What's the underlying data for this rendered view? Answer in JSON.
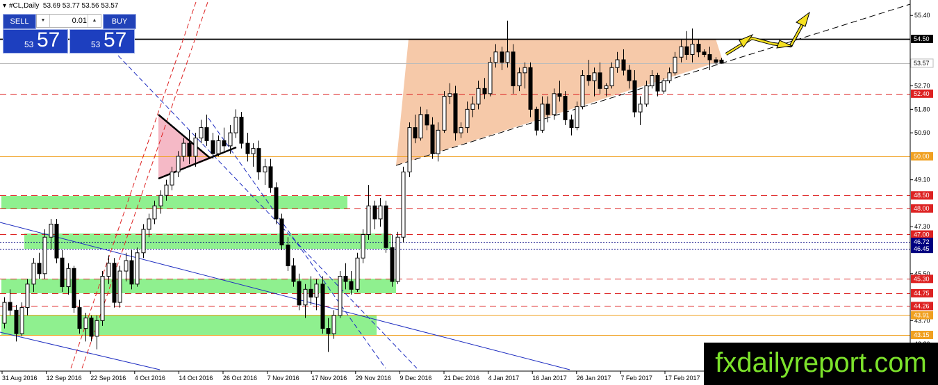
{
  "window": {
    "title": "#CL,Daily",
    "ohlc": "53.69 53.77 53.56 53.57"
  },
  "trade_panel": {
    "sell_label": "SELL",
    "buy_label": "BUY",
    "lot": "0.01",
    "sell_price_small": "53",
    "sell_price_big": "57",
    "buy_price_small": "53",
    "buy_price_big": "57"
  },
  "price_axis": {
    "ticks": [
      "55.40",
      "52.70",
      "51.80",
      "50.90",
      "49.10",
      "47.30",
      "45.50",
      "43.70",
      "42.80"
    ],
    "levels": [
      {
        "value": "54.50",
        "color": "#000000"
      },
      {
        "value": "53.57",
        "color": "#000000"
      },
      {
        "value": "52.40",
        "color": "#dd2222"
      },
      {
        "value": "50.00",
        "color": "#f0a020"
      },
      {
        "value": "48.50",
        "color": "#dd2222"
      },
      {
        "value": "48.00",
        "color": "#dd2222"
      },
      {
        "value": "47.00",
        "color": "#dd2222"
      },
      {
        "value": "46.72",
        "color": "#000080"
      },
      {
        "value": "46.45",
        "color": "#000080"
      },
      {
        "value": "45.30",
        "color": "#dd2222"
      },
      {
        "value": "44.75",
        "color": "#dd2222"
      },
      {
        "value": "44.26",
        "color": "#dd2222"
      },
      {
        "value": "43.91",
        "color": "#f0a020"
      },
      {
        "value": "43.15",
        "color": "#f0a020"
      }
    ]
  },
  "time_axis": [
    "31 Aug 2016",
    "12 Sep 2016",
    "22 Sep 2016",
    "4 Oct 2016",
    "14 Oct 2016",
    "26 Oct 2016",
    "7 Nov 2016",
    "17 Nov 2016",
    "29 Nov 2016",
    "9 Dec 2016",
    "21 Dec 2016",
    "4 Jan 2017",
    "16 Jan 2017",
    "26 Jan 2017",
    "7 Feb 2017",
    "17 Feb 2017"
  ],
  "watermark": "fxdailyreport.com",
  "colors": {
    "bull": "#ffffff",
    "bear": "#000000",
    "zone": "#8ff08f",
    "triangle": "#f5c09a",
    "pennant": "#f2a8b8"
  },
  "chart_data": {
    "type": "candlestick",
    "symbol": "#CL",
    "timeframe": "Daily",
    "last": {
      "open": 53.69,
      "high": 53.77,
      "low": 53.56,
      "close": 53.57
    },
    "price_range": [
      42.3,
      55.9
    ],
    "candles": [
      [
        43.6,
        44.6,
        43.4,
        44.4
      ],
      [
        44.4,
        44.9,
        43.9,
        44.1
      ],
      [
        44.1,
        44.3,
        42.9,
        43.2
      ],
      [
        43.2,
        44.4,
        43.1,
        44.2
      ],
      [
        44.2,
        45.3,
        43.9,
        45.1
      ],
      [
        45.1,
        46.1,
        44.8,
        45.9
      ],
      [
        45.9,
        46.3,
        45.3,
        45.5
      ],
      [
        45.5,
        47.2,
        45.3,
        46.9
      ],
      [
        46.9,
        47.6,
        46.4,
        47.4
      ],
      [
        47.4,
        47.6,
        45.9,
        46.1
      ],
      [
        46.1,
        46.4,
        44.8,
        45.0
      ],
      [
        45.0,
        45.9,
        44.7,
        45.7
      ],
      [
        45.7,
        45.8,
        44.0,
        44.2
      ],
      [
        44.2,
        44.5,
        43.2,
        43.4
      ],
      [
        43.4,
        44.0,
        42.9,
        43.8
      ],
      [
        43.8,
        43.9,
        42.9,
        43.1
      ],
      [
        43.1,
        43.9,
        42.6,
        43.7
      ],
      [
        43.7,
        45.6,
        43.5,
        45.4
      ],
      [
        45.4,
        46.2,
        45.1,
        45.9
      ],
      [
        45.9,
        46.1,
        44.2,
        44.4
      ],
      [
        44.4,
        45.8,
        44.2,
        45.6
      ],
      [
        45.6,
        46.3,
        45.2,
        46.0
      ],
      [
        46.0,
        46.4,
        44.9,
        45.1
      ],
      [
        45.1,
        46.5,
        45.0,
        46.3
      ],
      [
        46.3,
        47.4,
        46.1,
        47.2
      ],
      [
        47.2,
        47.8,
        46.9,
        47.6
      ],
      [
        47.6,
        48.3,
        47.4,
        48.1
      ],
      [
        48.1,
        48.7,
        47.8,
        48.5
      ],
      [
        48.5,
        49.1,
        48.3,
        48.9
      ],
      [
        48.9,
        49.6,
        48.7,
        49.4
      ],
      [
        49.4,
        50.2,
        49.2,
        50.0
      ],
      [
        50.0,
        50.7,
        49.8,
        50.5
      ],
      [
        50.5,
        51.0,
        49.7,
        50.0
      ],
      [
        50.0,
        50.9,
        49.6,
        50.7
      ],
      [
        50.7,
        51.4,
        50.5,
        51.1
      ],
      [
        51.1,
        51.6,
        50.4,
        50.6
      ],
      [
        50.6,
        50.9,
        49.9,
        50.1
      ],
      [
        50.1,
        50.8,
        50.0,
        50.6
      ],
      [
        50.6,
        51.1,
        50.2,
        50.4
      ],
      [
        50.4,
        51.2,
        50.1,
        50.9
      ],
      [
        50.9,
        51.8,
        50.7,
        51.5
      ],
      [
        51.5,
        51.7,
        50.3,
        50.5
      ],
      [
        50.5,
        50.9,
        49.8,
        50.1
      ],
      [
        50.1,
        50.5,
        49.6,
        50.3
      ],
      [
        50.3,
        50.6,
        49.1,
        49.4
      ],
      [
        49.4,
        49.9,
        48.9,
        49.6
      ],
      [
        49.6,
        49.9,
        48.6,
        48.8
      ],
      [
        48.8,
        49.0,
        47.4,
        47.6
      ],
      [
        47.6,
        47.8,
        46.4,
        46.6
      ],
      [
        46.6,
        46.9,
        45.6,
        45.8
      ],
      [
        45.8,
        46.1,
        45.0,
        45.2
      ],
      [
        45.2,
        45.5,
        44.1,
        44.3
      ],
      [
        44.3,
        45.1,
        43.8,
        44.9
      ],
      [
        44.9,
        45.4,
        44.3,
        44.6
      ],
      [
        44.6,
        45.3,
        44.1,
        45.1
      ],
      [
        45.1,
        45.4,
        43.2,
        43.4
      ],
      [
        43.4,
        43.8,
        42.5,
        43.2
      ],
      [
        43.2,
        44.1,
        43.0,
        43.9
      ],
      [
        43.9,
        45.6,
        43.8,
        45.4
      ],
      [
        45.4,
        45.9,
        44.9,
        45.2
      ],
      [
        45.2,
        45.6,
        44.7,
        44.9
      ],
      [
        44.9,
        46.3,
        44.8,
        46.1
      ],
      [
        46.1,
        47.2,
        45.9,
        47.0
      ],
      [
        47.0,
        48.9,
        46.8,
        48.1
      ],
      [
        48.1,
        48.3,
        47.2,
        47.6
      ],
      [
        47.6,
        48.4,
        47.3,
        48.1
      ],
      [
        48.1,
        48.3,
        46.3,
        46.5
      ],
      [
        46.5,
        47.0,
        45.0,
        45.2
      ],
      [
        45.2,
        47.1,
        45.1,
        46.9
      ],
      [
        46.9,
        49.6,
        46.7,
        49.4
      ],
      [
        49.4,
        51.3,
        49.2,
        51.1
      ],
      [
        51.1,
        51.6,
        50.5,
        50.7
      ],
      [
        50.7,
        51.9,
        50.6,
        51.6
      ],
      [
        51.6,
        51.8,
        51.0,
        51.2
      ],
      [
        51.2,
        51.5,
        49.9,
        50.1
      ],
      [
        50.1,
        51.3,
        49.8,
        51.0
      ],
      [
        51.0,
        52.5,
        50.9,
        52.3
      ],
      [
        52.3,
        52.8,
        52.0,
        52.4
      ],
      [
        52.4,
        52.7,
        50.6,
        50.9
      ],
      [
        50.9,
        51.3,
        50.7,
        51.1
      ],
      [
        51.1,
        52.1,
        50.9,
        51.8
      ],
      [
        51.8,
        52.3,
        51.5,
        52.0
      ],
      [
        52.0,
        52.9,
        51.8,
        52.6
      ],
      [
        52.6,
        53.0,
        52.2,
        52.4
      ],
      [
        52.4,
        53.8,
        52.3,
        53.6
      ],
      [
        53.6,
        54.3,
        53.4,
        54.0
      ],
      [
        54.0,
        54.2,
        53.3,
        53.6
      ],
      [
        53.6,
        55.2,
        53.4,
        54.0
      ],
      [
        54.0,
        54.3,
        52.4,
        52.7
      ],
      [
        52.7,
        53.4,
        52.5,
        53.2
      ],
      [
        53.2,
        53.6,
        52.6,
        53.4
      ],
      [
        53.4,
        53.6,
        51.5,
        51.8
      ],
      [
        51.8,
        51.9,
        50.8,
        51.0
      ],
      [
        51.0,
        52.3,
        50.9,
        52.0
      ],
      [
        52.0,
        52.3,
        51.3,
        51.6
      ],
      [
        51.6,
        52.6,
        51.4,
        52.4
      ],
      [
        52.4,
        52.9,
        52.1,
        52.3
      ],
      [
        52.3,
        52.5,
        51.2,
        51.4
      ],
      [
        51.4,
        51.6,
        50.8,
        51.1
      ],
      [
        51.1,
        52.1,
        51.0,
        51.9
      ],
      [
        51.9,
        53.3,
        51.8,
        53.1
      ],
      [
        53.1,
        53.7,
        52.7,
        52.9
      ],
      [
        52.9,
        53.4,
        52.3,
        53.2
      ],
      [
        53.2,
        53.6,
        52.4,
        52.6
      ],
      [
        52.6,
        52.8,
        52.3,
        52.7
      ],
      [
        52.7,
        53.6,
        52.6,
        53.4
      ],
      [
        53.4,
        54.0,
        53.2,
        53.7
      ],
      [
        53.7,
        54.1,
        53.1,
        53.3
      ],
      [
        53.3,
        53.5,
        52.6,
        52.9
      ],
      [
        52.9,
        53.3,
        51.5,
        51.7
      ],
      [
        51.7,
        52.3,
        51.2,
        52.0
      ],
      [
        52.0,
        52.9,
        51.9,
        52.7
      ],
      [
        52.7,
        53.3,
        52.6,
        53.1
      ],
      [
        53.1,
        53.2,
        52.3,
        52.5
      ],
      [
        52.5,
        53.0,
        52.4,
        52.9
      ],
      [
        52.9,
        53.4,
        52.8,
        53.2
      ],
      [
        53.2,
        54.0,
        53.1,
        53.8
      ],
      [
        53.8,
        54.5,
        53.6,
        54.2
      ],
      [
        54.2,
        54.8,
        53.7,
        53.9
      ],
      [
        53.9,
        54.9,
        53.6,
        54.3
      ],
      [
        54.3,
        54.5,
        53.8,
        54.0
      ],
      [
        54.0,
        54.1,
        53.8,
        53.9
      ],
      [
        53.9,
        54.2,
        53.3,
        53.7
      ],
      [
        53.7,
        53.8,
        53.5,
        53.6
      ],
      [
        53.69,
        53.77,
        53.56,
        53.57
      ]
    ]
  }
}
